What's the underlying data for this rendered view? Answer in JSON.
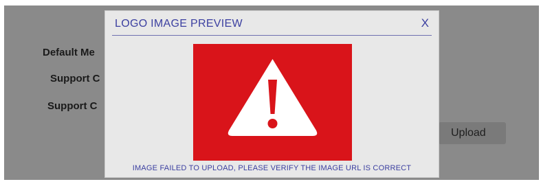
{
  "background_form": {
    "labels": [
      "Default Me",
      "Support C",
      "Support C"
    ],
    "upload_button_label": "Upload"
  },
  "modal": {
    "title": "LOGO IMAGE PREVIEW",
    "close_label": "X",
    "message": "IMAGE FAILED TO UPLOAD, PLEASE VERIFY THE IMAGE URL IS CORRECT",
    "image_icon": "warning-triangle-icon"
  },
  "colors": {
    "accent": "#3b3fa0",
    "error_red": "#d9141a",
    "overlay_gray": "#8a8a8a"
  }
}
